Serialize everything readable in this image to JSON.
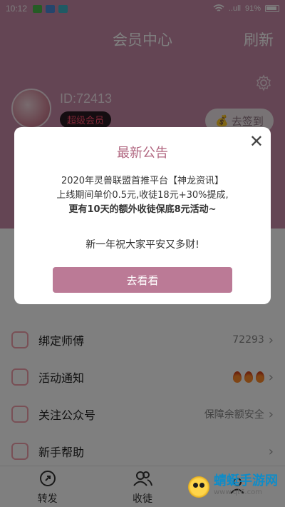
{
  "status_bar": {
    "time": "10:12",
    "signal": "..ull",
    "battery": "91%"
  },
  "header": {
    "title": "会员中心",
    "refresh": "刷新"
  },
  "profile": {
    "id_text": "ID:72413",
    "vip_badge": "超级会员",
    "checkin_label": "去签到"
  },
  "menu": [
    {
      "label": "绑定师傅",
      "right_text": "72293",
      "icon": "user-icon"
    },
    {
      "label": "活动通知",
      "right_text": "",
      "icon": "bell-icon",
      "badges": 3
    },
    {
      "label": "关注公众号",
      "right_text": "保障余额安全",
      "icon": "heart-icon"
    },
    {
      "label": "新手帮助",
      "right_text": "",
      "icon": "help-icon"
    }
  ],
  "bottom_nav": [
    {
      "label": "转发",
      "icon": "share-icon"
    },
    {
      "label": "收徒",
      "icon": "users-icon"
    },
    {
      "label": "",
      "icon": "profile-icon"
    }
  ],
  "modal": {
    "title": "最新公告",
    "line1": "2020年灵兽联盟首推平台【神龙资讯】",
    "line2": "上线期间单价0.5元,收徒18元+30%提成,",
    "line3": "更有10天的额外收徒保底8元活动~",
    "greeting": "新一年祝大家平安又多财!",
    "button": "去看看"
  },
  "watermark": {
    "brand": "蜻蜓手游网",
    "site": "www.qt6.com"
  },
  "colors": {
    "accent": "#c98aa8",
    "modal_title": "#b0657f",
    "button": "#bb7a96"
  }
}
